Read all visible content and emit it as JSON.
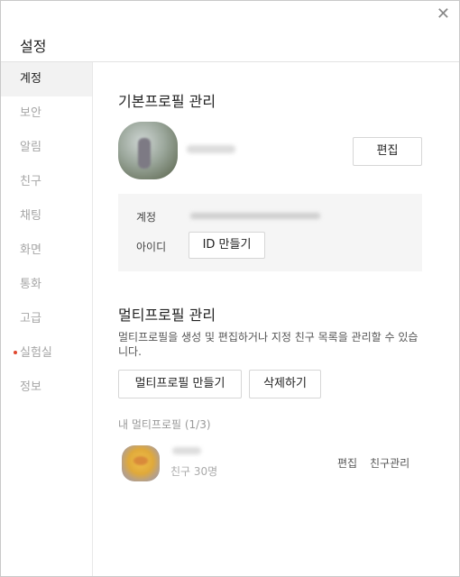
{
  "window": {
    "title": "설정",
    "close_glyph": "✕"
  },
  "sidebar": {
    "items": [
      {
        "label": "계정",
        "active": true
      },
      {
        "label": "보안"
      },
      {
        "label": "알림"
      },
      {
        "label": "친구"
      },
      {
        "label": "채팅"
      },
      {
        "label": "화면"
      },
      {
        "label": "통화"
      },
      {
        "label": "고급"
      },
      {
        "label": "실험실",
        "new_badge": true
      },
      {
        "label": "정보"
      }
    ]
  },
  "basic_profile": {
    "heading": "기본프로필 관리",
    "edit_button": "편집",
    "account_label": "계정",
    "id_label": "아이디",
    "create_id_button": "ID 만들기"
  },
  "multi_profile": {
    "heading": "멀티프로필 관리",
    "description": "멀티프로필을 생성 및 편집하거나 지정 친구 목록을 관리할 수 있습니다.",
    "create_button": "멀티프로필 만들기",
    "delete_button": "삭제하기",
    "list_header": "내 멀티프로필 (1/3)",
    "items": [
      {
        "friends": "친구 30명",
        "edit_link": "편집",
        "manage_link": "친구관리"
      }
    ]
  },
  "colors": {
    "accent_dot": "#e0472f",
    "active_bg": "#f2f2f2",
    "muted_text": "#a6a6a6"
  }
}
